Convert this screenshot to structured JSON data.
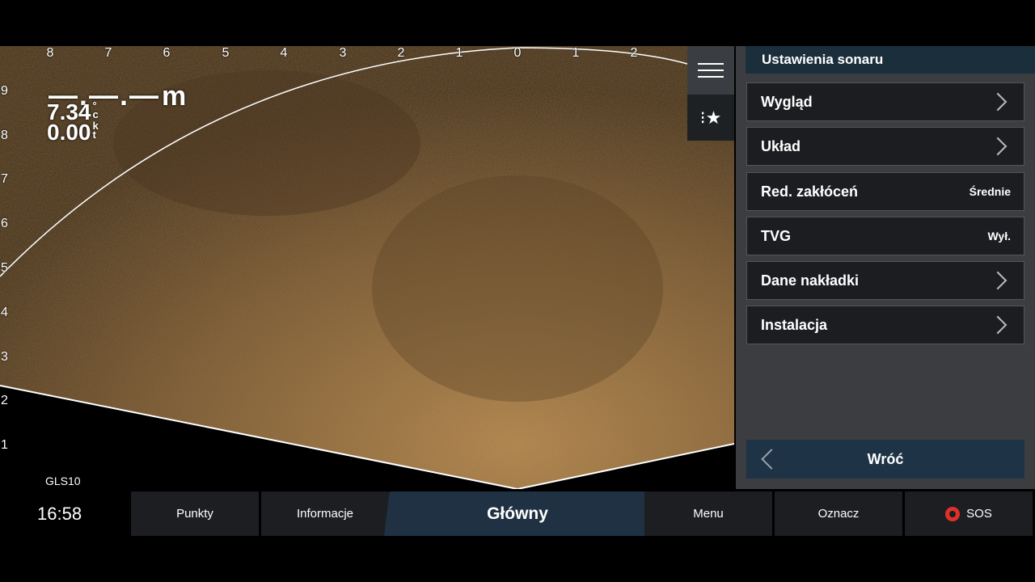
{
  "sonar": {
    "scale_top": [
      "8",
      "7",
      "6",
      "5",
      "4",
      "3",
      "2",
      "1",
      "0",
      "1",
      "2"
    ],
    "scale_left": [
      "9",
      "8",
      "7",
      "6",
      "5",
      "4",
      "3",
      "2",
      "1"
    ],
    "depth": "—.—.—",
    "depth_unit": "m",
    "water_temp": "7.34",
    "water_temp_unit": "°c",
    "speed": "0.00",
    "speed_unit": "kt",
    "source": "GLS10"
  },
  "panel": {
    "title": "Ustawienia sonaru",
    "items": [
      {
        "label": "Wygląd",
        "value": ""
      },
      {
        "label": "Układ",
        "value": ""
      },
      {
        "label": "Red. zakłóceń",
        "value": "Średnie"
      },
      {
        "label": "TVG",
        "value": "Wył."
      },
      {
        "label": "Dane nakładki",
        "value": ""
      },
      {
        "label": "Instalacja",
        "value": ""
      }
    ],
    "back_label": "Wróć"
  },
  "bottom_bar": {
    "time": "16:58",
    "tabs": [
      "Punkty",
      "Informacje",
      "Główny",
      "Menu",
      "Oznacz",
      "SOS"
    ]
  },
  "colors": {
    "sonar_base": "#6e5230",
    "sonar_light": "#a57c45",
    "panel_bg": "#3b3d40",
    "panel_title_bg": "#1b2e3c",
    "active_tab": "#1f3142"
  }
}
